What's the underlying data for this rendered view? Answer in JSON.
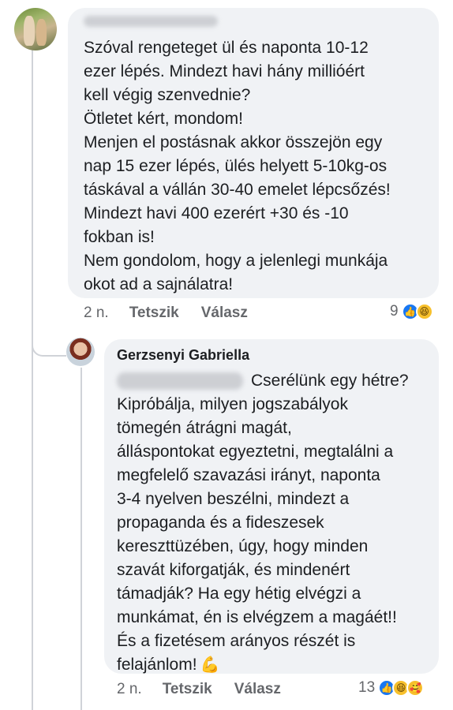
{
  "comment": {
    "text_lines": [
      "Szóval rengeteget ül és naponta 10-12",
      "ezer lépés. Mindezt havi hány millióért",
      "kell végig szenvednie?",
      "Ötletet kért, mondom!",
      "Menjen el postásnak akkor összejön egy",
      "nap 15 ezer lépés, ülés helyett 5-10kg-os",
      "táskával a vállán 30-40 emelet lépcsőzés!",
      "Mindezt havi 400 ezerért +30 és -10",
      "fokban is!",
      "Nem gondolom, hogy a jelenlegi munkája",
      "okot ad a sajnálatra!"
    ],
    "time": "2 n.",
    "like_label": "Tetszik",
    "reply_label": "Válasz",
    "reaction_count": "9",
    "reaction_icons": [
      "like-icon",
      "haha-icon"
    ]
  },
  "reply": {
    "author": "Gerzsenyi Gabriella",
    "text_lines": [
      "Cserélünk egy hétre?",
      "Kipróbálja, milyen jogszabályok",
      "tömegén átrágni magát,",
      "álláspontokat egyeztetni, megtalálni a",
      "megfelelő szavazási irányt, naponta",
      "3-4 nyelven beszélni, mindezt a",
      "propaganda és a fideszesek",
      "kereszttüzében, úgy, hogy minden",
      "szavát kiforgatják, és mindenért",
      "támadják? Ha egy hétig elvégzi a",
      "munkámat, én is elvégzem a magáét!!",
      "És a fizetésem arányos részét is",
      "felajánlom!"
    ],
    "emoji": "💪",
    "time": "2 n.",
    "like_label": "Tetszik",
    "reply_label": "Válasz",
    "reaction_count": "13",
    "reaction_icons": [
      "like-icon",
      "haha-icon",
      "care-icon"
    ]
  }
}
